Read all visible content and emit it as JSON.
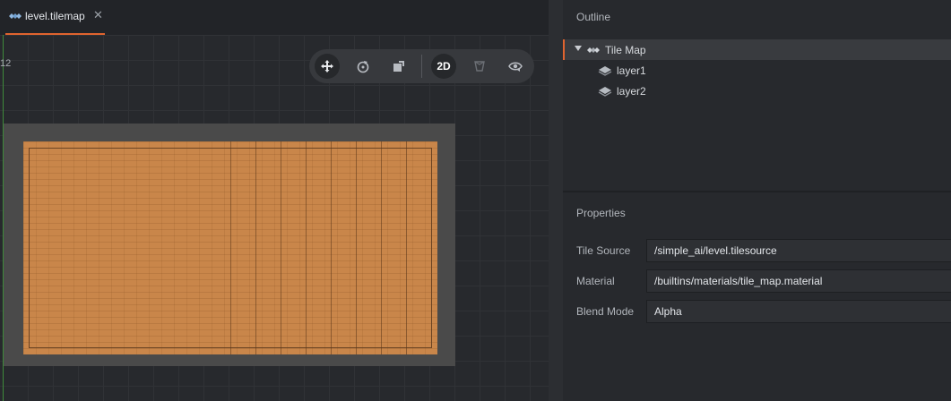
{
  "tab": {
    "label": "level.tilemap",
    "icon": "tilemap-icon",
    "close_glyph": "✕"
  },
  "viewport": {
    "ruler_label": "12",
    "toolbar": {
      "tools": [
        {
          "name": "move-tool",
          "icon": "move-icon",
          "active": true
        },
        {
          "name": "rotate-tool",
          "icon": "rotate-icon",
          "active": false
        },
        {
          "name": "scale-tool",
          "icon": "scale-icon",
          "active": false
        },
        {
          "name": "2d-toggle",
          "label": "2D",
          "active": true
        },
        {
          "name": "perspective-toggle",
          "icon": "camera-frustum-icon",
          "active": false
        },
        {
          "name": "visibility-filter",
          "icon": "eye-icon",
          "active": false
        }
      ]
    }
  },
  "outline": {
    "title": "Outline",
    "items": [
      {
        "label": "Tile Map",
        "icon": "tilemap-icon",
        "expanded": true,
        "selected": true,
        "depth": 0
      },
      {
        "label": "layer1",
        "icon": "layer-icon",
        "selected": false,
        "depth": 1
      },
      {
        "label": "layer2",
        "icon": "layer-icon",
        "selected": false,
        "depth": 1
      }
    ]
  },
  "properties": {
    "title": "Properties",
    "fields": [
      {
        "label": "Tile Source",
        "value": "/simple_ai/level.tilesource"
      },
      {
        "label": "Material",
        "value": "/builtins/materials/tile_map.material"
      },
      {
        "label": "Blend Mode",
        "value": "Alpha"
      }
    ]
  },
  "colors": {
    "accent": "#e0642f",
    "tile_fill": "#c9864a",
    "map_border": "#4a4a4a",
    "y_axis": "#3f8a3a"
  }
}
